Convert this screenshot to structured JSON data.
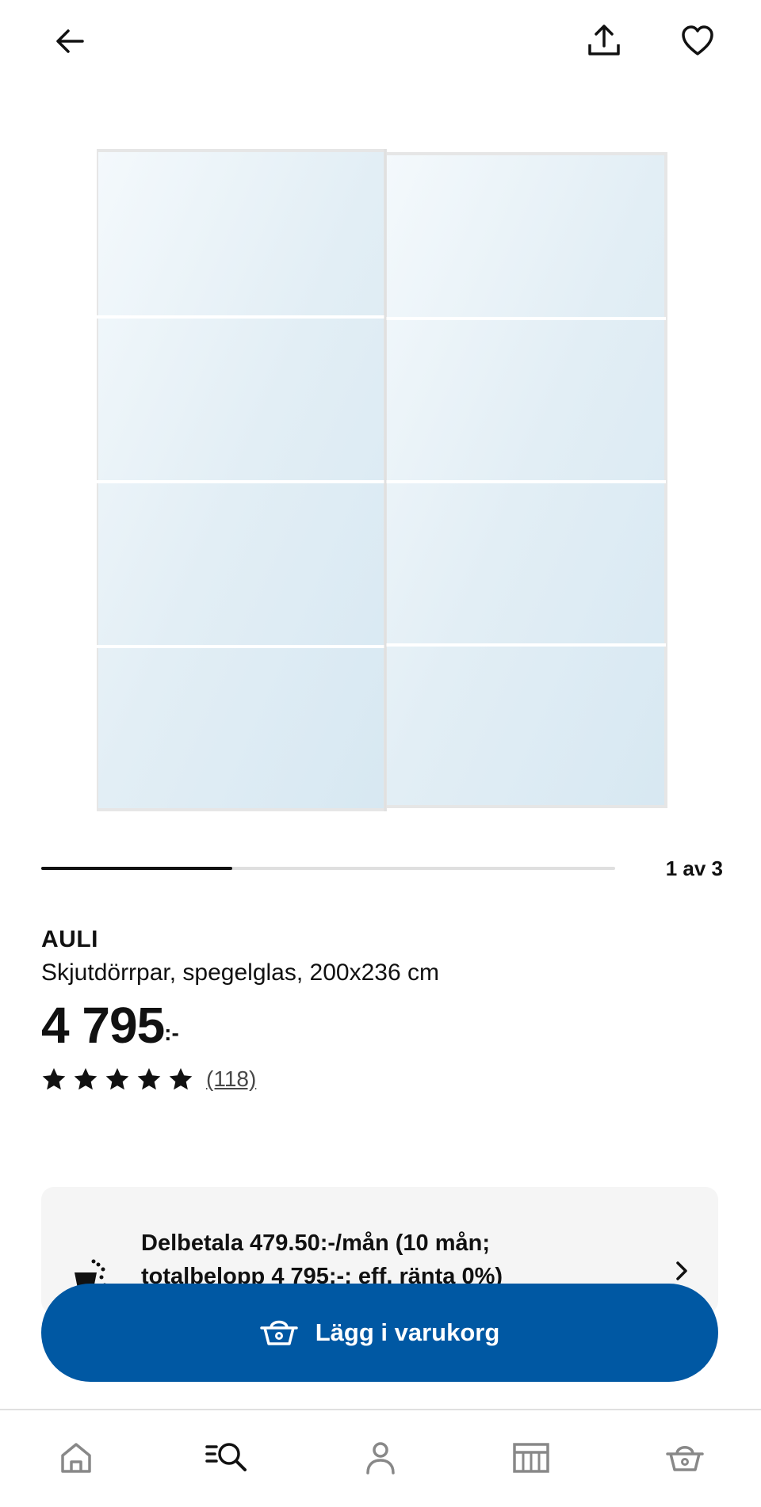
{
  "header": {
    "back_icon": "arrow-left-icon",
    "share_icon": "share-icon",
    "favorite_icon": "heart-icon"
  },
  "gallery": {
    "image_description_icon": "sliding-mirror-doors-image",
    "current_page": 1,
    "total_pages": 3,
    "page_label": "1 av 3"
  },
  "product": {
    "name": "AULI",
    "description": "Skjutdörrpar, spegelglas, 200x236 cm",
    "price": "4 795",
    "price_suffix": ":-",
    "rating": 5,
    "max_rating": 5,
    "review_count": "(118)"
  },
  "installment": {
    "icon": "payment-icon",
    "text": "Delbetala 479.50:-/mån (10 mån; totalbelopp 4 795:-; eff. ränta 0%)",
    "chevron_icon": "chevron-right-icon"
  },
  "cart_button": {
    "label": "Lägg i varukorg",
    "icon": "basket-icon"
  },
  "bottom_nav": {
    "items": [
      {
        "icon": "home-icon"
      },
      {
        "icon": "search-browse-icon"
      },
      {
        "icon": "profile-icon"
      },
      {
        "icon": "store-icon"
      },
      {
        "icon": "basket-icon"
      }
    ]
  },
  "colors": {
    "primary_blue": "#0058a3",
    "text": "#111111",
    "card_bg": "#f5f5f5",
    "mirror": "#e3eef5"
  }
}
